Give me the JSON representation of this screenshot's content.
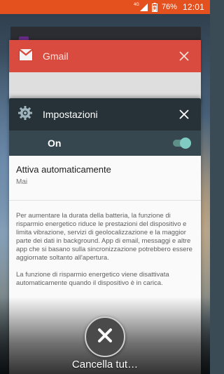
{
  "status_bar": {
    "network_label": "4G",
    "battery_percent": "76%",
    "time": "12:01",
    "color": "#e4511e"
  },
  "recents": {
    "gmail_card": {
      "title": "Gmail",
      "icon": "gmail-envelope-icon",
      "header_color": "#d84b3e"
    },
    "settings_card": {
      "title": "Impostazioni",
      "icon": "gear-icon",
      "header_color": "#263238",
      "toggle": {
        "label": "On",
        "state": true
      },
      "auto_activate": {
        "title": "Attiva automaticamente",
        "value": "Mai"
      },
      "description_1": "Per aumentare la durata della batteria, la funzione di risparmio energetico riduce le prestazioni del dispositivo e limita vibrazione, servizi di geolocalizzazione e la maggior parte dei dati in background. App di email, messaggi e altre app che si basano sulla sincronizzazione potrebbero essere aggiornate soltanto all'apertura.",
      "description_2": "La funzione di risparmio energetico viene disattivata automaticamente quando il dispositivo è in carica."
    }
  },
  "clear_all": {
    "label": "Cancella tut…",
    "icon": "close-icon"
  }
}
